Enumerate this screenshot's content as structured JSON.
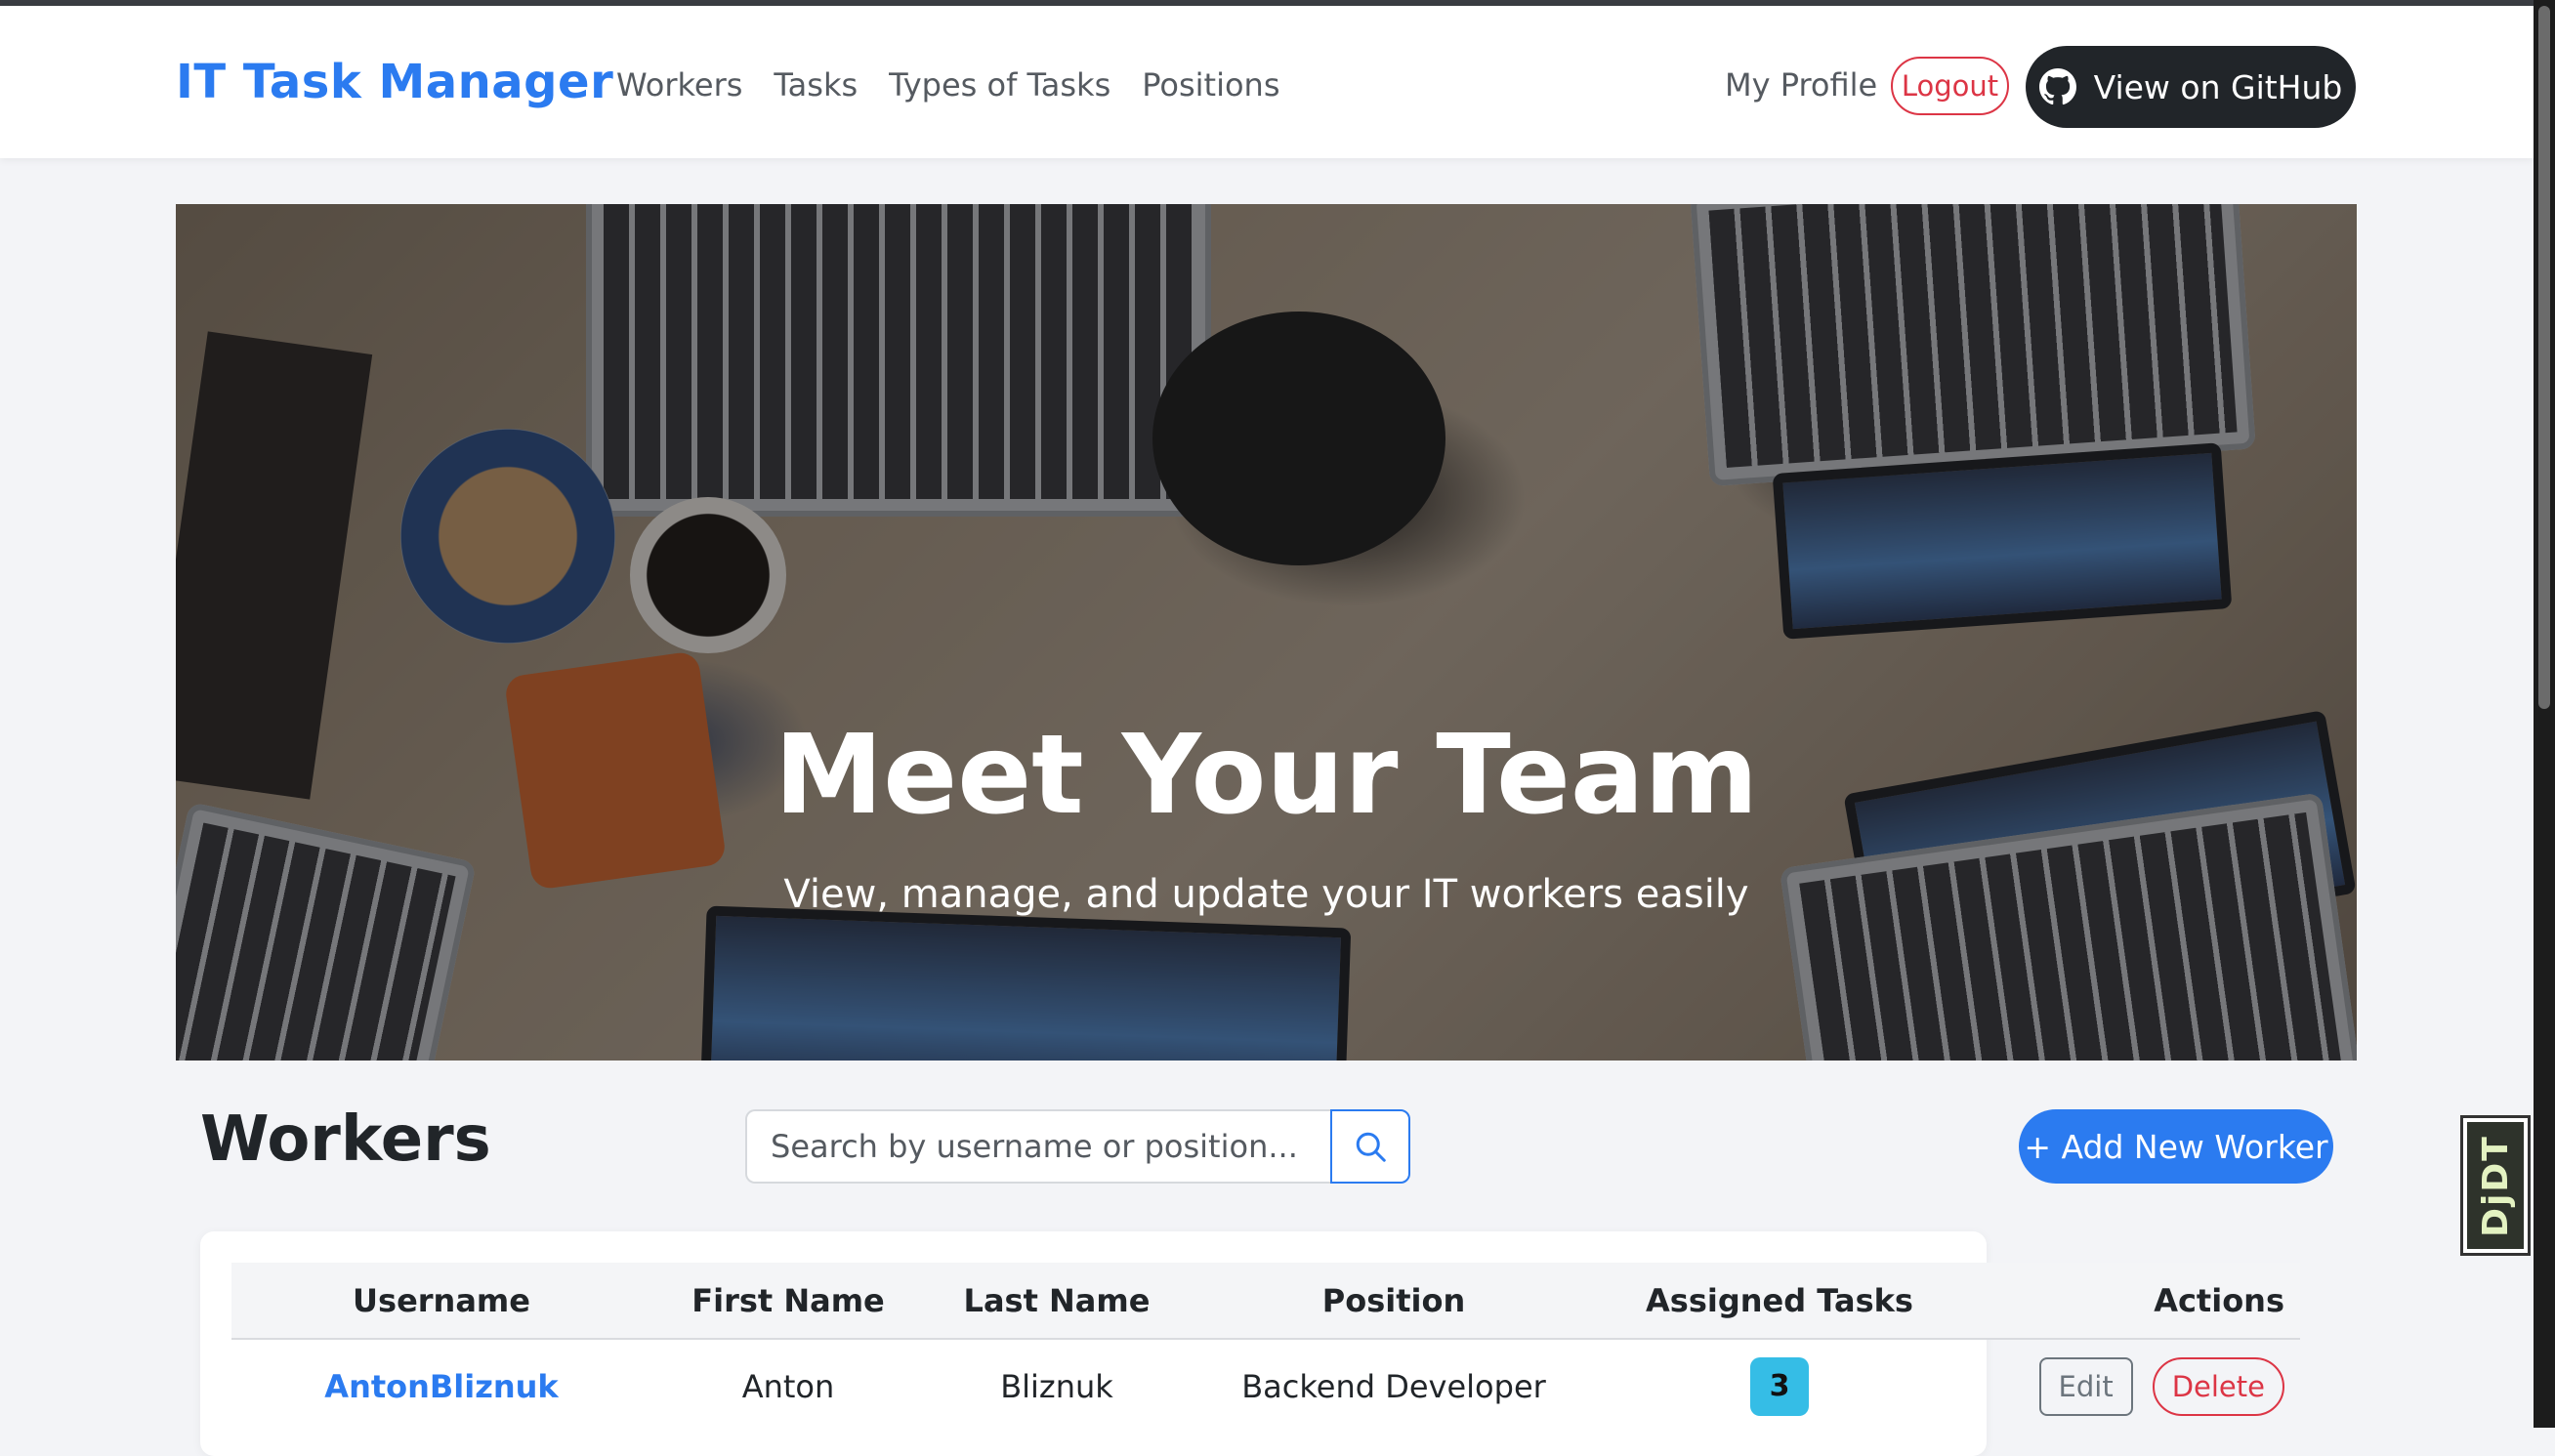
{
  "navbar": {
    "brand": "IT Task Manager",
    "links": [
      "Workers",
      "Tasks",
      "Types of Tasks",
      "Positions"
    ],
    "my_profile": "My Profile",
    "logout": "Logout",
    "github": "View on GitHub"
  },
  "hero": {
    "title": "Meet Your Team",
    "subtitle": "View, manage, and update your IT workers easily"
  },
  "workers_section": {
    "title": "Workers",
    "search_placeholder": "Search by username or position...",
    "add_button": "+ Add New Worker"
  },
  "table": {
    "headers": [
      "Username",
      "First Name",
      "Last Name",
      "Position",
      "Assigned Tasks",
      "Actions"
    ],
    "rows": [
      {
        "username": "AntonBliznuk",
        "first_name": "Anton",
        "last_name": "Bliznuk",
        "position": "Backend Developer",
        "assigned_tasks": "3",
        "edit": "Edit",
        "delete": "Delete"
      }
    ]
  },
  "debug_toolbar": {
    "label": "DjDT"
  },
  "colors": {
    "accent": "#2b7bf0",
    "danger": "#dc3545",
    "badge": "#35bde6",
    "dark": "#212529"
  }
}
